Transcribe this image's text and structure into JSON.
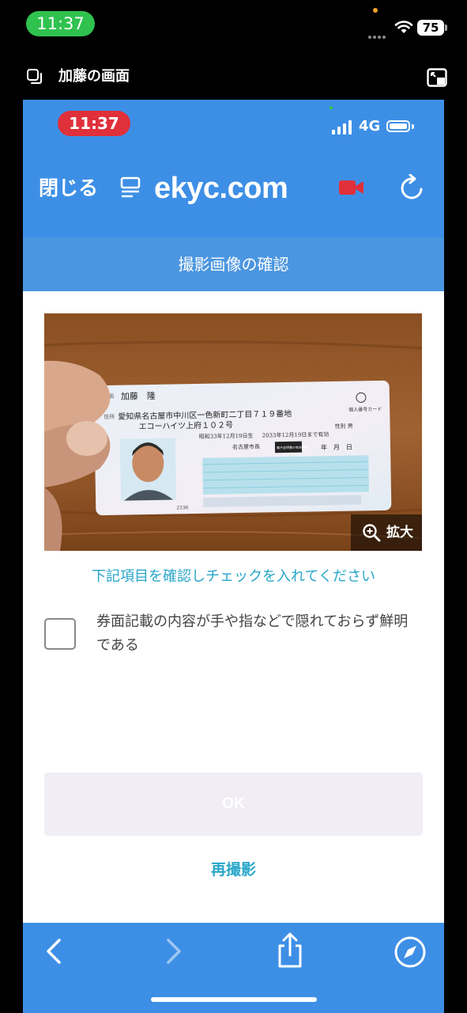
{
  "outer_status": {
    "time": "11:37",
    "battery": "75"
  },
  "share_header": {
    "title": "加藤の画面"
  },
  "inner_status": {
    "time": "11:37",
    "network": "4G"
  },
  "browser": {
    "close_label": "閉じる",
    "site_title": "ekyc.com"
  },
  "page": {
    "title": "撮影画像の確認",
    "zoom_label": "拡大",
    "instruction": "下記項目を確認しチェックを入れてください",
    "checkbox_label": "券面記載の内容が手や指などで隠れておらず鮮明である",
    "ok_label": "OK",
    "retake_label": "再撮影"
  },
  "card": {
    "name_label": "氏名",
    "name": "加藤　隆",
    "address_label": "住所",
    "address_line1": "愛知県名古屋市中川区一色新町二丁目７１９番地",
    "address_line2": "エコーハイツ上府１０２号",
    "birth": "昭和33年12月19日生",
    "valid_until": "2033年12月19日まで有効",
    "sex": "性別 男",
    "issuer": "名古屋市長",
    "seal_box": "電子証明書の有効期限",
    "date_labels": "年　月　日",
    "badge": "個人番号カード",
    "code": "2336"
  },
  "colors": {
    "header_blue": "#3d8fe6",
    "page_bar_blue": "#4b96e0",
    "accent_teal": "#27a6c9",
    "rec_red": "#e0303a",
    "ok_disabled": "#f1edf4"
  },
  "icons": {
    "menu": "list-icon",
    "record": "video-camera-icon",
    "reload": "reload-icon",
    "zoom": "zoom-in-icon",
    "back": "chevron-left-icon",
    "forward": "chevron-right-icon",
    "share": "share-icon",
    "compass": "compass-icon"
  }
}
